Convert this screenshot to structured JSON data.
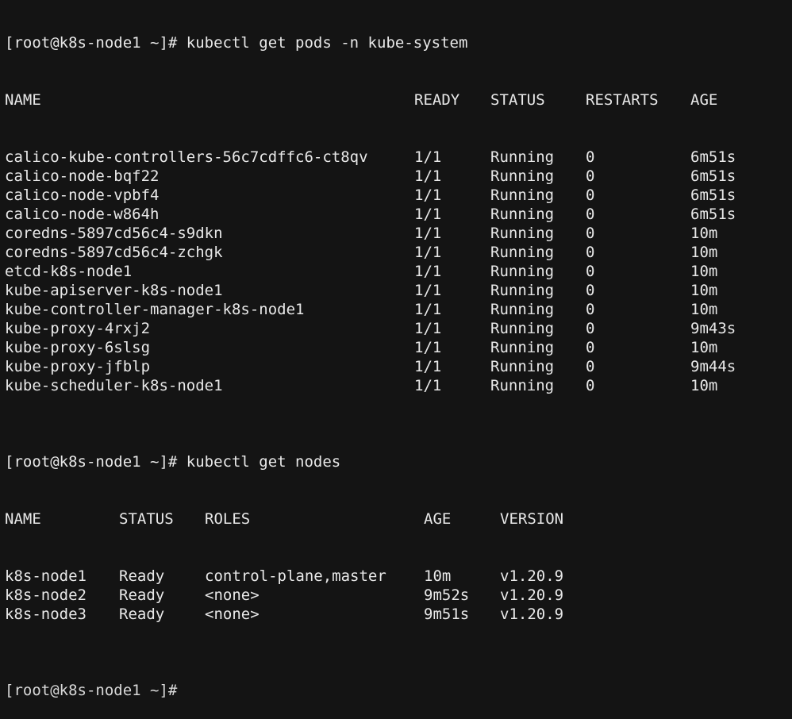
{
  "pods_cmd": {
    "prompt": "[root@k8s-node1 ~]#",
    "command": " kubectl get pods -n kube-system"
  },
  "pods": {
    "headers": [
      "NAME",
      "READY",
      "STATUS",
      "RESTARTS",
      "AGE"
    ],
    "rows": [
      [
        "calico-kube-controllers-56c7cdffc6-ct8qv",
        "1/1",
        "Running",
        "0",
        "6m51s"
      ],
      [
        "calico-node-bqf22",
        "1/1",
        "Running",
        "0",
        "6m51s"
      ],
      [
        "calico-node-vpbf4",
        "1/1",
        "Running",
        "0",
        "6m51s"
      ],
      [
        "calico-node-w864h",
        "1/1",
        "Running",
        "0",
        "6m51s"
      ],
      [
        "coredns-5897cd56c4-s9dkn",
        "1/1",
        "Running",
        "0",
        "10m"
      ],
      [
        "coredns-5897cd56c4-zchgk",
        "1/1",
        "Running",
        "0",
        "10m"
      ],
      [
        "etcd-k8s-node1",
        "1/1",
        "Running",
        "0",
        "10m"
      ],
      [
        "kube-apiserver-k8s-node1",
        "1/1",
        "Running",
        "0",
        "10m"
      ],
      [
        "kube-controller-manager-k8s-node1",
        "1/1",
        "Running",
        "0",
        "10m"
      ],
      [
        "kube-proxy-4rxj2",
        "1/1",
        "Running",
        "0",
        "9m43s"
      ],
      [
        "kube-proxy-6slsg",
        "1/1",
        "Running",
        "0",
        "10m"
      ],
      [
        "kube-proxy-jfblp",
        "1/1",
        "Running",
        "0",
        "9m44s"
      ],
      [
        "kube-scheduler-k8s-node1",
        "1/1",
        "Running",
        "0",
        "10m"
      ]
    ]
  },
  "nodes_cmd": {
    "prompt": "[root@k8s-node1 ~]#",
    "command": " kubectl get nodes"
  },
  "nodes": {
    "headers": [
      "NAME",
      "STATUS",
      "ROLES",
      "AGE",
      "VERSION"
    ],
    "rows": [
      [
        "k8s-node1",
        "Ready",
        "control-plane,master",
        "10m",
        "v1.20.9"
      ],
      [
        "k8s-node2",
        "Ready",
        "<none>",
        "9m52s",
        "v1.20.9"
      ],
      [
        "k8s-node3",
        "Ready",
        "<none>",
        "9m51s",
        "v1.20.9"
      ]
    ]
  },
  "last_prompt": "[root@k8s-node1 ~]#"
}
